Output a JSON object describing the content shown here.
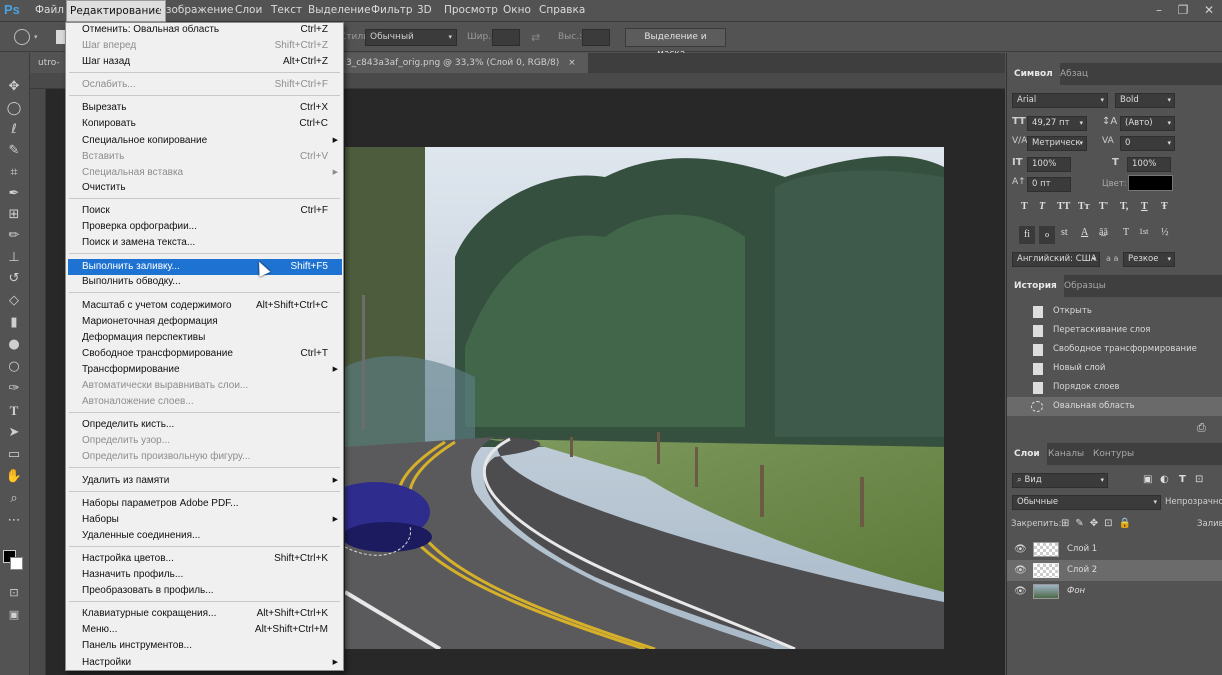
{
  "menubar": {
    "logo": "Ps",
    "items": [
      "Файл",
      "Редактирование",
      "Изображение",
      "Слои",
      "Текст",
      "Выделение",
      "Фильтр",
      "3D",
      "Просмотр",
      "Окно",
      "Справка"
    ]
  },
  "options": {
    "style_label": "Стили:",
    "style_value": "Обычный",
    "width_label": "Шир.:",
    "height_label": "Выс.:",
    "select_mask_button": "Выделение и маска..."
  },
  "documents": {
    "tab1": "utro-d",
    "tab2_suffix": "3_c843a3af_orig.png @ 33,3% (Слой 0, RGB/8)",
    "tab2_close": "×"
  },
  "edit_menu": {
    "items": [
      {
        "label": "Отменить: Овальная область",
        "shortcut": "Ctrl+Z",
        "disabled": false
      },
      {
        "label": "Шаг вперед",
        "shortcut": "Shift+Ctrl+Z",
        "disabled": true
      },
      {
        "label": "Шаг назад",
        "shortcut": "Alt+Ctrl+Z",
        "disabled": false
      },
      {
        "label": "Ослабить...",
        "shortcut": "Shift+Ctrl+F",
        "disabled": true
      },
      {
        "label": "Вырезать",
        "shortcut": "Ctrl+X",
        "disabled": false
      },
      {
        "label": "Копировать",
        "shortcut": "Ctrl+C",
        "disabled": false
      },
      {
        "label": "Специальное копирование",
        "shortcut": "",
        "disabled": false,
        "submenu": true
      },
      {
        "label": "Вставить",
        "shortcut": "Ctrl+V",
        "disabled": true
      },
      {
        "label": "Специальная вставка",
        "shortcut": "",
        "disabled": true,
        "submenu": true
      },
      {
        "label": "Очистить",
        "shortcut": "",
        "disabled": false
      },
      {
        "label": "Поиск",
        "shortcut": "Ctrl+F",
        "disabled": false
      },
      {
        "label": "Проверка орфографии...",
        "shortcut": "",
        "disabled": false
      },
      {
        "label": "Поиск и замена текста...",
        "shortcut": "",
        "disabled": false
      },
      {
        "label": "Выполнить заливку...",
        "shortcut": "Shift+F5",
        "disabled": false,
        "highlighted": true
      },
      {
        "label": "Выполнить обводку...",
        "shortcut": "",
        "disabled": false
      },
      {
        "label": "Масштаб с учетом содержимого",
        "shortcut": "Alt+Shift+Ctrl+C",
        "disabled": false
      },
      {
        "label": "Марионеточная деформация",
        "shortcut": "",
        "disabled": false
      },
      {
        "label": "Деформация перспективы",
        "shortcut": "",
        "disabled": false
      },
      {
        "label": "Свободное трансформирование",
        "shortcut": "Ctrl+T",
        "disabled": false
      },
      {
        "label": "Трансформирование",
        "shortcut": "",
        "disabled": false,
        "submenu": true
      },
      {
        "label": "Автоматически выравнивать слои...",
        "shortcut": "",
        "disabled": true
      },
      {
        "label": "Автоналожение слоев...",
        "shortcut": "",
        "disabled": true
      },
      {
        "label": "Определить кисть...",
        "shortcut": "",
        "disabled": false
      },
      {
        "label": "Определить узор...",
        "shortcut": "",
        "disabled": true
      },
      {
        "label": "Определить произвольную фигуру...",
        "shortcut": "",
        "disabled": true
      },
      {
        "label": "Удалить из памяти",
        "shortcut": "",
        "disabled": false,
        "submenu": true
      },
      {
        "label": "Наборы параметров Adobe PDF...",
        "shortcut": "",
        "disabled": false
      },
      {
        "label": "Наборы",
        "shortcut": "",
        "disabled": false,
        "submenu": true
      },
      {
        "label": "Удаленные соединения...",
        "shortcut": "",
        "disabled": false
      },
      {
        "label": "Настройка цветов...",
        "shortcut": "Shift+Ctrl+K",
        "disabled": false
      },
      {
        "label": "Назначить профиль...",
        "shortcut": "",
        "disabled": false
      },
      {
        "label": "Преобразовать в профиль...",
        "shortcut": "",
        "disabled": false
      },
      {
        "label": "Клавиатурные сокращения...",
        "shortcut": "Alt+Shift+Ctrl+K",
        "disabled": false
      },
      {
        "label": "Меню...",
        "shortcut": "Alt+Shift+Ctrl+M",
        "disabled": false
      },
      {
        "label": "Панель инструментов...",
        "shortcut": "",
        "disabled": false
      },
      {
        "label": "Настройки",
        "shortcut": "",
        "disabled": false,
        "submenu": true
      }
    ]
  },
  "character_panel": {
    "tabs": [
      "Символ",
      "Абзац"
    ],
    "font_family": "Arial",
    "font_style": "Bold",
    "font_size": "49,27 пт",
    "leading": "(Авто)",
    "kerning": "Метрическ",
    "tracking": "0",
    "vscale": "100%",
    "hscale": "100%",
    "baseline": "0 пт",
    "color_label": "Цвет:",
    "color_value": "#000000",
    "style_buttons": [
      "T",
      "T",
      "TT",
      "Tт",
      "T'",
      "T,",
      "T",
      "Ŧ"
    ],
    "opentype_buttons": [
      "fi",
      "ℴ",
      "st",
      "A",
      "ā̲ā",
      "T",
      "1st",
      "½"
    ],
    "language": "Английский: США",
    "aa_label": "a a",
    "antialias": "Резкое"
  },
  "history_panel": {
    "tabs": [
      "История",
      "Образцы"
    ],
    "items": [
      "Открыть",
      "Перетаскивание слоя",
      "Свободное трансформирование",
      "Новый слой",
      "Порядок слоев",
      "Овальная область"
    ]
  },
  "layers_panel": {
    "tabs": [
      "Слои",
      "Каналы",
      "Контуры"
    ],
    "filter_label": "Вид",
    "blend_mode": "Обычные",
    "opacity_label": "Непрозрачность:",
    "lock_label": "Закрепить:",
    "fill_label": "Заливка:",
    "layers": [
      {
        "name": "Слой 1",
        "selected": false
      },
      {
        "name": "Слой 2",
        "selected": true
      },
      {
        "name": "Фон",
        "selected": false
      }
    ]
  },
  "colors": {
    "menu_highlight": "#1e73d2",
    "ps_logo": "#4aa3e0"
  }
}
